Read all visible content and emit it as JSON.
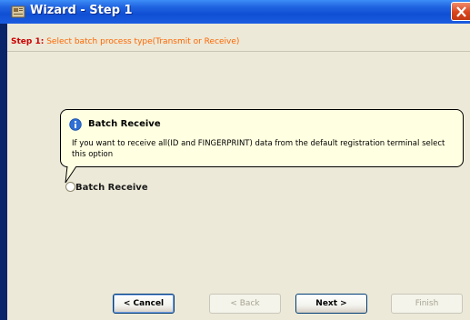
{
  "window": {
    "title": "Wizard - Step 1",
    "icons": {
      "app": "app-icon",
      "close": "close-icon"
    }
  },
  "step": {
    "number_label": "Step 1",
    "separator": ":",
    "description": "Select batch process type(Transmit or Receive)"
  },
  "tooltip": {
    "icon": "info-icon",
    "title": "Batch Receive",
    "body": "If you want to receive all(ID and FINGERPRINT) data from the default registration terminal select this option"
  },
  "option": {
    "label": "Batch Receive",
    "selected": false
  },
  "buttons": {
    "cancel": "< Cancel",
    "back": "< Back",
    "next": "Next >",
    "finish": "Finish"
  },
  "colors": {
    "titlebar": "#0f4fd4",
    "step_number": "#cc0000",
    "step_text": "#ff6600",
    "tooltip_bg": "#ffffe1",
    "dialog_bg": "#ece9d8"
  }
}
